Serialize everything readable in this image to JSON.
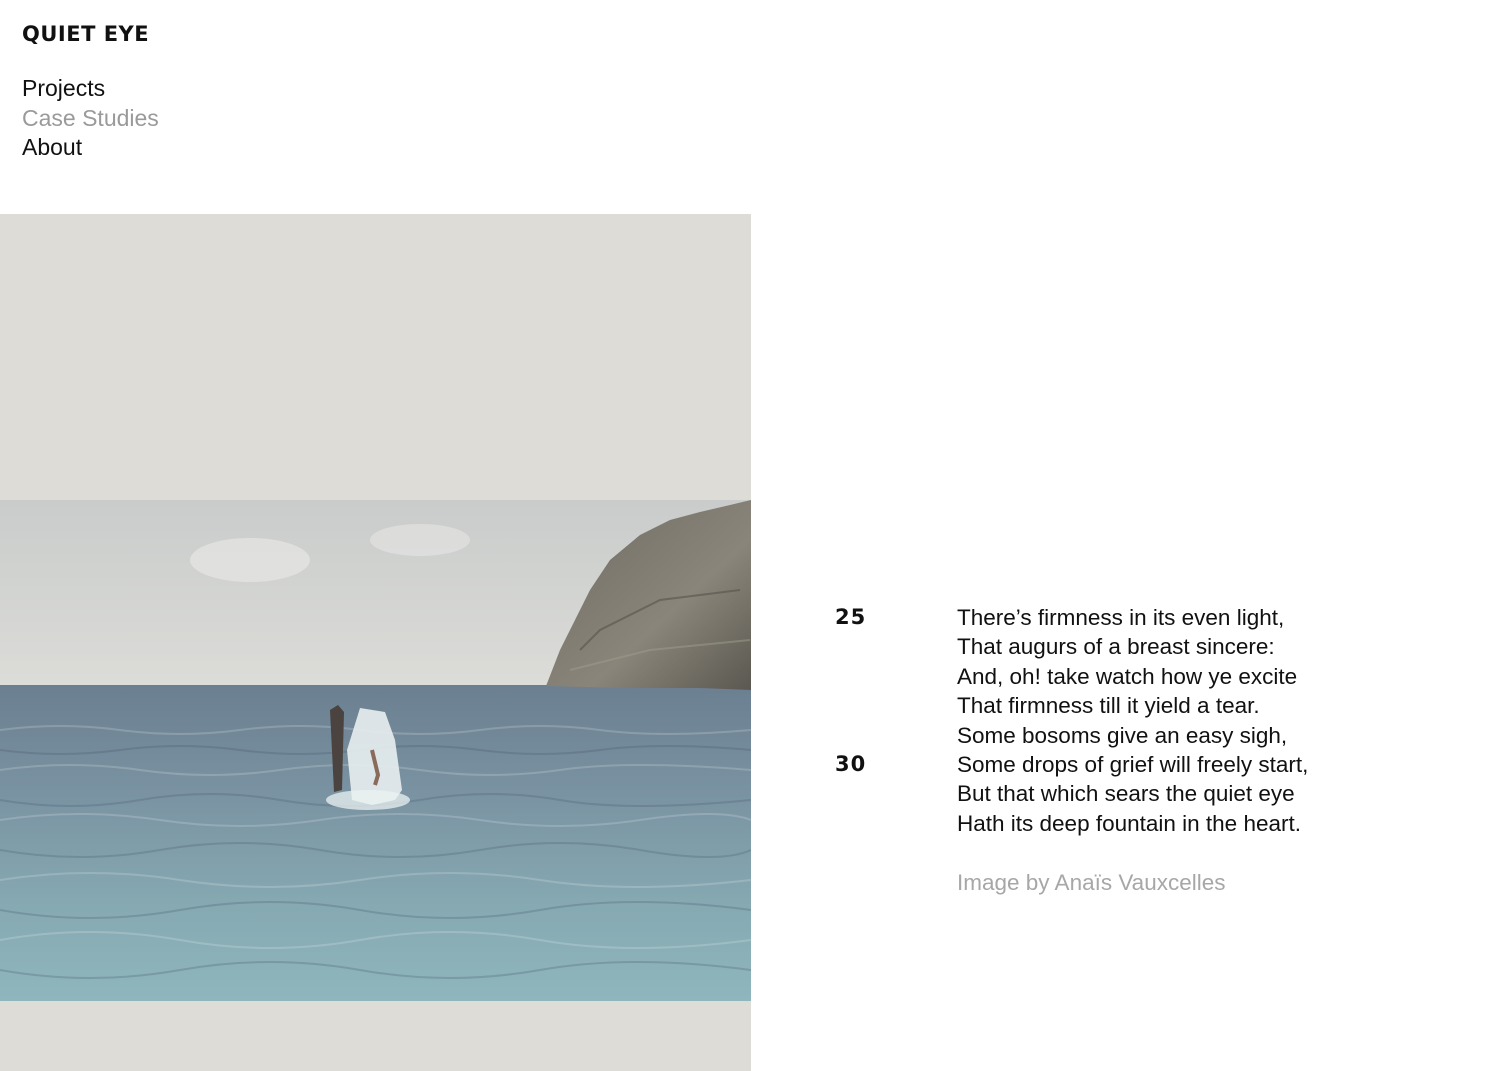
{
  "site": {
    "brand": "QUIET EYE"
  },
  "nav": {
    "items": [
      {
        "label": "Projects"
      },
      {
        "label": "Case Studies"
      },
      {
        "label": "About"
      }
    ]
  },
  "poem": {
    "line_number_markers": [
      "25",
      "30"
    ],
    "lines": [
      "There’s firmness in its even light,",
      "That augurs of a breast sincere:",
      "And, oh! take watch how ye excite",
      "That firmness till it yield a tear.",
      "Some bosoms give an easy sigh,",
      "Some drops of grief will freely start,",
      "But that which sears the quiet eye",
      "Hath its deep fountain in the heart."
    ]
  },
  "credit": "Image by Anaïs Vauxcelles",
  "colors": {
    "background": "#ffffff",
    "photo_panel": "#dedcd7",
    "muted_text": "#9a9a9a",
    "credit_text": "#a7a7a7",
    "text": "#111111"
  }
}
